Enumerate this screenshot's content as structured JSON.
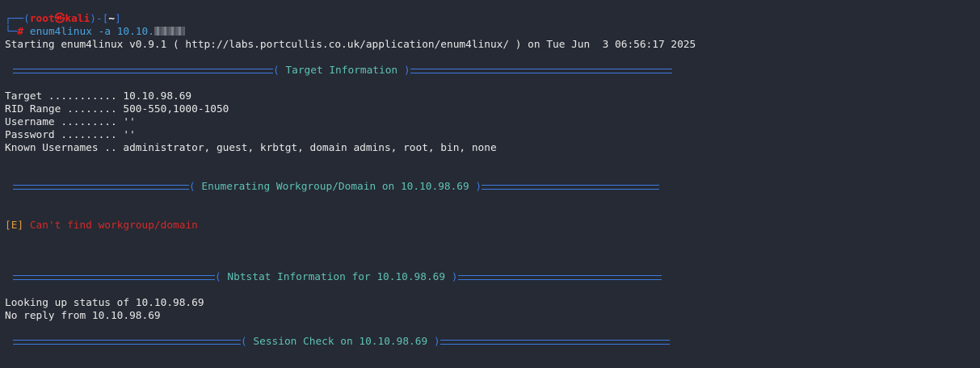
{
  "prompt": {
    "top_corner": "┌──(",
    "user": "root",
    "at_symbol": "㉿",
    "host": "kali",
    "close_host": ")-[",
    "cwd": "~",
    "close_cwd": "]",
    "bottom_corner": "└─",
    "hash": "#",
    "command": "enum4linux",
    "args": " -a 10.10."
  },
  "output": {
    "start_line": "Starting enum4linux v0.9.1 ( http://labs.portcullis.co.uk/application/enum4linux/ ) on Tue Jun  3 06:56:17 2025",
    "target_info": {
      "title": "Target Information",
      "lines": [
        "Target ........... 10.10.98.69",
        "RID Range ........ 500-550,1000-1050",
        "Username ......... ''",
        "Password ......... ''",
        "Known Usernames .. administrator, guest, krbtgt, domain admins, root, bin, none"
      ]
    },
    "workgroup": {
      "title": "Enumerating Workgroup/Domain on 10.10.98.69",
      "error_tag": "[E]",
      "error_text": "Can't find workgroup/domain"
    },
    "nbtstat": {
      "title": "Nbtstat Information for 10.10.98.69",
      "lines": [
        "Looking up status of 10.10.98.69",
        "No reply from 10.10.98.69"
      ]
    },
    "session": {
      "title": "Session Check on 10.10.98.69"
    }
  },
  "colors": {
    "background": "#252a34",
    "prompt_blue": "#3d7ae0",
    "root_red": "#e52020",
    "banner_teal": "#5fc2b5",
    "error_orange": "#e39a3c",
    "error_red": "#d32a2a"
  }
}
